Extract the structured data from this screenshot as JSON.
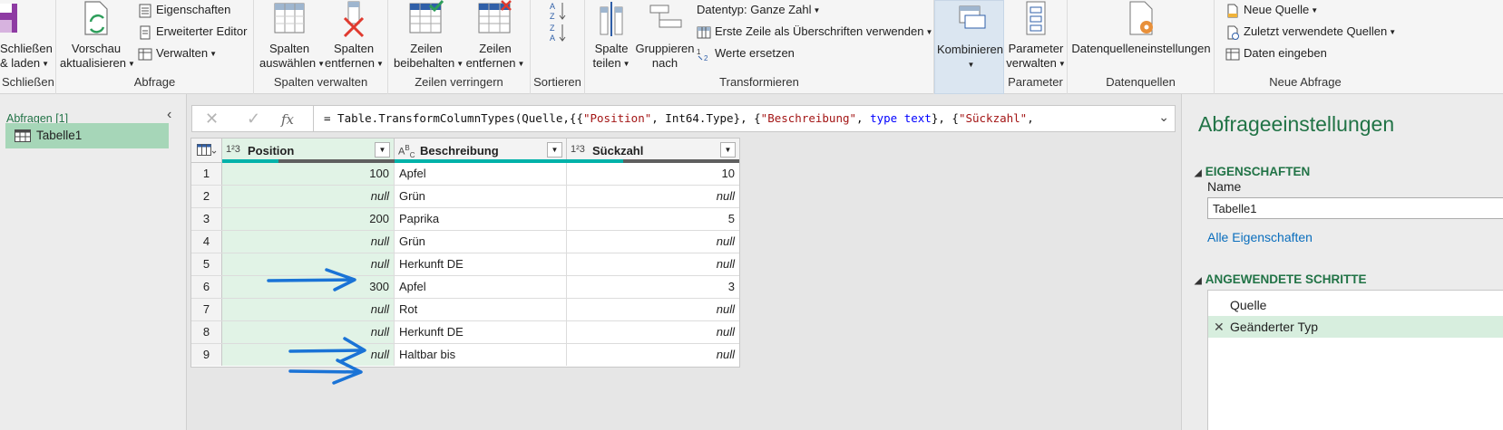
{
  "ribbon": {
    "groups": {
      "close": "Schließen",
      "query": "Abfrage",
      "manage_columns": "Spalten verwalten",
      "reduce_rows": "Zeilen verringern",
      "sort": "Sortieren",
      "transform": "Transformieren",
      "combine": "",
      "parameters": "Parameter",
      "data_sources": "Datenquellen",
      "new_query": "Neue Abfrage"
    },
    "close_load": [
      "Schließen",
      "& laden"
    ],
    "preview_refresh": [
      "Vorschau",
      "aktualisieren"
    ],
    "properties": "Eigenschaften",
    "advanced_editor": "Erweiterter Editor",
    "manage": "Verwalten",
    "choose_columns": [
      "Spalten",
      "auswählen"
    ],
    "remove_columns": [
      "Spalten",
      "entfernen"
    ],
    "keep_rows": [
      "Zeilen",
      "beibehalten"
    ],
    "remove_rows": [
      "Zeilen",
      "entfernen"
    ],
    "split_column": [
      "Spalte",
      "teilen"
    ],
    "group_by": [
      "Gruppieren",
      "nach"
    ],
    "datatype": "Datentyp: Ganze Zahl",
    "first_row_headers": "Erste Zeile als Überschriften verwenden",
    "replace_values": "Werte ersetzen",
    "combine": "Kombinieren",
    "manage_parameters": [
      "Parameter",
      "verwalten"
    ],
    "data_source_settings": "Datenquelleneinstellungen",
    "new_source": "Neue Quelle",
    "recent_sources": "Zuletzt verwendete Quellen",
    "enter_data": "Daten eingeben"
  },
  "left": {
    "header": "Abfragen [1]",
    "query_name": "Tabelle1"
  },
  "formula": {
    "prefix": "= Table.TransformColumnTypes(Quelle,{{",
    "s1": "\"Position\"",
    "p2": ", Int64.Type}, {",
    "s2": "\"Beschreibung\"",
    "p3": ", ",
    "kw_type": "type",
    "kw_text": "text",
    "p4": "}, {",
    "s3": "\"Sückzahl\"",
    "p5": ","
  },
  "grid": {
    "columns": [
      {
        "type": "1²3",
        "name": "Position"
      },
      {
        "type": "A^B_C",
        "name": "Beschreibung"
      },
      {
        "type": "1²3",
        "name": "Sückzahl"
      }
    ],
    "rows": [
      {
        "n": "1",
        "pos": "100",
        "desc": "Apfel",
        "qty": "10"
      },
      {
        "n": "2",
        "pos": "null",
        "desc": "Grün",
        "qty": "null"
      },
      {
        "n": "3",
        "pos": "200",
        "desc": "Paprika",
        "qty": "5"
      },
      {
        "n": "4",
        "pos": "null",
        "desc": "Grün",
        "qty": "null"
      },
      {
        "n": "5",
        "pos": "null",
        "desc": "Herkunft DE",
        "qty": "null"
      },
      {
        "n": "6",
        "pos": "300",
        "desc": "Apfel",
        "qty": "3"
      },
      {
        "n": "7",
        "pos": "null",
        "desc": "Rot",
        "qty": "null"
      },
      {
        "n": "8",
        "pos": "null",
        "desc": "Herkunft DE",
        "qty": "null"
      },
      {
        "n": "9",
        "pos": "null",
        "desc": "Haltbar bis",
        "qty": "null"
      }
    ],
    "colors": {
      "valid": "#00b2a9",
      "empty": "#5f5f5f",
      "arrow": "#1a73d6"
    }
  },
  "right": {
    "title": "Abfrageeinstellungen",
    "properties_header": "EIGENSCHAFTEN",
    "name_label": "Name",
    "name_value": "Tabelle1",
    "all_properties": "Alle Eigenschaften",
    "steps_header": "ANGEWENDETE SCHRITTE",
    "steps": [
      "Quelle",
      "Geänderter Typ"
    ]
  }
}
